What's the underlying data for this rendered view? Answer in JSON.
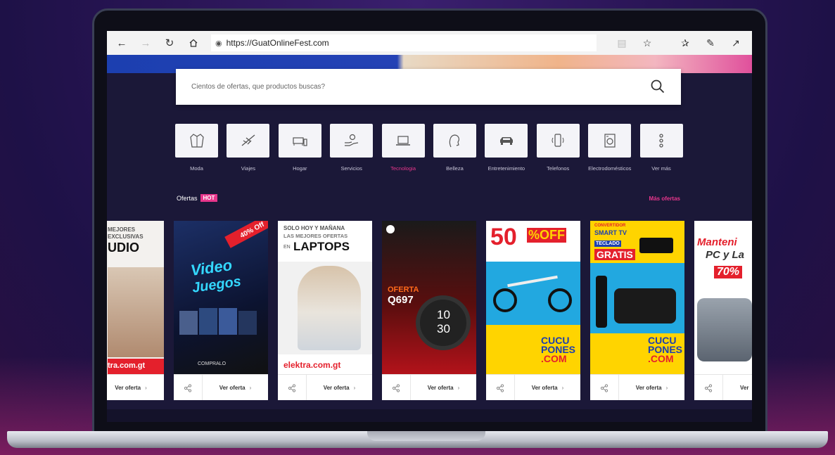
{
  "browser": {
    "url": "https://GuatOnlineFest.com"
  },
  "search": {
    "placeholder": "Cientos de ofertas, que productos buscas?"
  },
  "categories": [
    {
      "label": "Moda",
      "icon": "jacket-icon"
    },
    {
      "label": "Viajes",
      "icon": "airplane-icon"
    },
    {
      "label": "Hogar",
      "icon": "sofa-icon"
    },
    {
      "label": "Servicios",
      "icon": "service-hand-icon"
    },
    {
      "label": "Tecnologia",
      "icon": "laptop-icon",
      "active": true
    },
    {
      "label": "Belleza",
      "icon": "beauty-face-icon"
    },
    {
      "label": "Entretenimiento",
      "icon": "car-icon"
    },
    {
      "label": "Telefonos",
      "icon": "phone-icon"
    },
    {
      "label": "Electrodomésticos",
      "icon": "washing-machine-icon"
    },
    {
      "label": "Ver más",
      "icon": "more-dots-icon"
    }
  ],
  "hot": {
    "title": "Ofertas",
    "badge": "HOT",
    "more": "Más ofertas"
  },
  "offers": [
    {
      "ad": {
        "l1": "MEJORES",
        "l2": "EXCLUSIVAS",
        "l3": "UDIO",
        "domain": "tra.com.gt"
      },
      "cta": "Ver oferta"
    },
    {
      "ad": {
        "l1": "Video",
        "l2": "Juegos",
        "badge": "40% Off",
        "brand": "COMPRALO"
      },
      "cta": "Ver oferta"
    },
    {
      "ad": {
        "l1": "SOLO HOY Y MAÑANA",
        "l2": "LAS MEJORES OFERTAS",
        "l3": "EN",
        "l4": "LAPTOPS",
        "domain": "elektra.com.gt"
      },
      "cta": "Ver oferta"
    },
    {
      "ad": {
        "l1": "OFERTA",
        "l2": "Q697",
        "time1": "10",
        "time2": "30"
      },
      "cta": "Ver oferta"
    },
    {
      "ad": {
        "l1": "50",
        "l2": "%OFF",
        "brand1": "CUCU",
        "brand2": "PONES",
        "brand3": ".COM"
      },
      "cta": "Ver oferta"
    },
    {
      "ad": {
        "l1": "CONVERTIDOR",
        "l2": "SMART TV",
        "l3": "TECLADO",
        "l4": "GRATIS",
        "brand1": "CUCU",
        "brand2": "PONES",
        "brand3": ".COM"
      },
      "cta": "Ver oferta"
    },
    {
      "ad": {
        "l1": "Manteni",
        "l2": "PC y La",
        "l3": "70%"
      },
      "cta": "Ver"
    }
  ],
  "colors": {
    "accent": "#e8368c",
    "page_bg": "#1b1838"
  }
}
